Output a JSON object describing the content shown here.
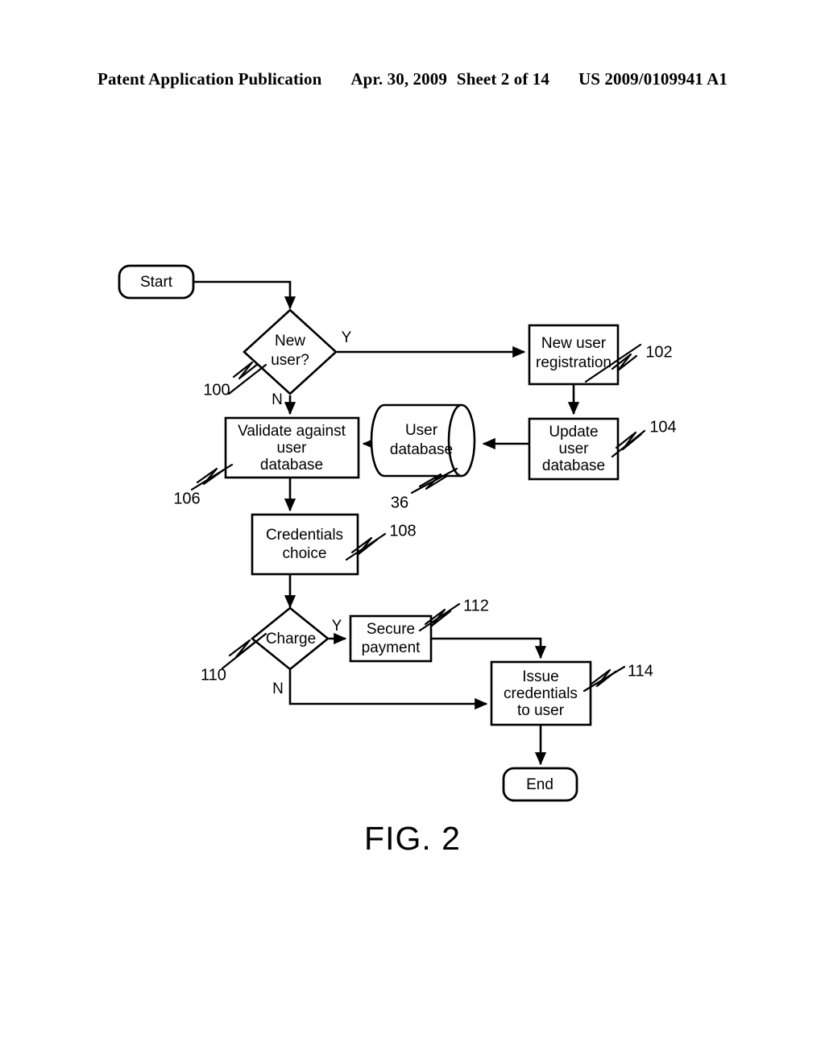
{
  "header": {
    "publication": "Patent Application Publication",
    "date": "Apr. 30, 2009",
    "sheet": "Sheet 2 of 14",
    "patent_number": "US 2009/0109941 A1"
  },
  "figure": {
    "caption": "FIG. 2",
    "type": "flowchart"
  },
  "nodes": {
    "start": {
      "label": "Start",
      "shape": "terminator"
    },
    "new_user": {
      "label_line1": "New",
      "label_line2": "user?",
      "shape": "decision",
      "ref": "100"
    },
    "new_user_registration": {
      "label_line1": "New user",
      "label_line2": "registration",
      "shape": "process",
      "ref": "102"
    },
    "update_user_database": {
      "label_line1": "Update",
      "label_line2": "user",
      "label_line3": "database",
      "shape": "process",
      "ref": "104"
    },
    "user_database": {
      "label_line1": "User",
      "label_line2": "database",
      "shape": "database",
      "ref": "36"
    },
    "validate_against_user_database": {
      "label_line1": "Validate against",
      "label_line2": "user",
      "label_line3": "database",
      "shape": "process",
      "ref": "106"
    },
    "credentials_choice": {
      "label_line1": "Credentials",
      "label_line2": "choice",
      "shape": "process",
      "ref": "108"
    },
    "charge": {
      "label": "Charge",
      "shape": "decision",
      "ref": "110"
    },
    "secure_payment": {
      "label_line1": "Secure",
      "label_line2": "payment",
      "shape": "process",
      "ref": "112"
    },
    "issue_credentials": {
      "label_line1": "Issue",
      "label_line2": "credentials",
      "label_line3": "to user",
      "shape": "process",
      "ref": "114"
    },
    "end": {
      "label": "End",
      "shape": "terminator"
    }
  },
  "branches": {
    "new_user_yes": "Y",
    "new_user_no": "N",
    "charge_yes": "Y",
    "charge_no": "N"
  },
  "colors": {
    "ink": "#000000",
    "paper": "#ffffff"
  }
}
